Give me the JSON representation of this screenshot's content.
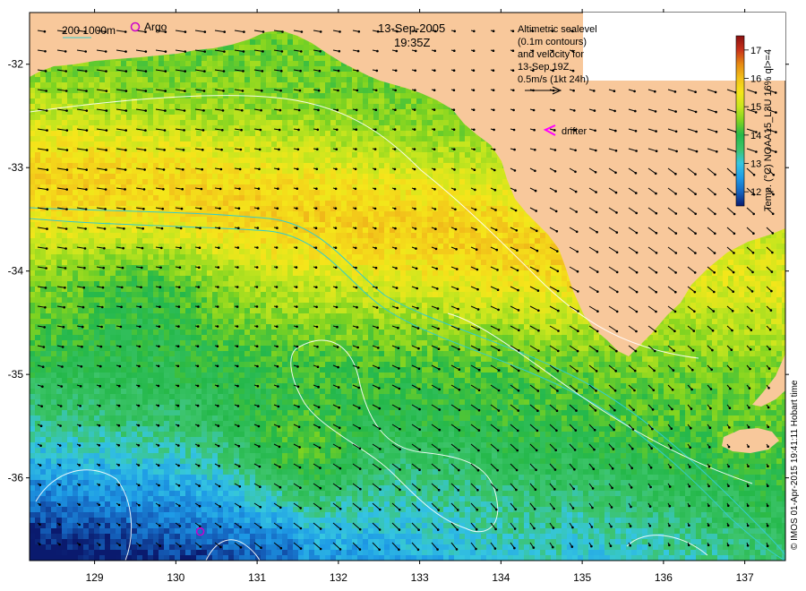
{
  "header": {
    "date": "13-Sep-2005",
    "time": "19:35Z"
  },
  "legend": {
    "isobath_labels": "200  1000m",
    "argo_label": "Argo",
    "drifter_label": "drifter",
    "argo_color": "#cc00cc",
    "drifter_color": "#ff00ff",
    "isobath_color": "#33cccc"
  },
  "info_box": {
    "lines": [
      "Altimetric sealevel",
      "(0.1m contours)",
      "and velocity for",
      "13-Sep 19Z",
      "0.5m/s (1kt 24h)"
    ]
  },
  "colorbar": {
    "label": "Temp. (°C) NOAA15_L3U 16% ql>=4",
    "ticks": [
      "17",
      "16",
      "15",
      "14",
      "13",
      "12"
    ],
    "tick_values": [
      17,
      16,
      15,
      14,
      13,
      12
    ],
    "min": 11.5,
    "max": 17.5,
    "colormap": [
      "#0a1a6e",
      "#1565c0",
      "#1e9be6",
      "#35c6e0",
      "#3cc46a",
      "#24b84a",
      "#7ed321",
      "#c8e61e",
      "#f5e61a",
      "#f2c21a",
      "#e68a12",
      "#c8321a",
      "#8b1010"
    ]
  },
  "axes": {
    "x_ticks": [
      "129",
      "130",
      "131",
      "132",
      "133",
      "134",
      "135",
      "136",
      "137"
    ],
    "x_values": [
      129,
      130,
      131,
      132,
      133,
      134,
      135,
      136,
      137
    ],
    "y_ticks": [
      "-32",
      "-33",
      "-34",
      "-35",
      "-36"
    ],
    "y_values": [
      -32,
      -33,
      -34,
      -35,
      -36
    ],
    "lon_range": [
      128.2,
      137.5
    ],
    "lat_range": [
      -36.8,
      -31.5
    ]
  },
  "copyright": "© IMOS 01-Apr-2015 19:41:11 Hobart time",
  "colors": {
    "land": "#f8c89b",
    "frame": "#000000",
    "contour": "#ffffff",
    "arrow": "#000000"
  },
  "argo_float": {
    "lon": 130.3,
    "lat": -36.52
  }
}
